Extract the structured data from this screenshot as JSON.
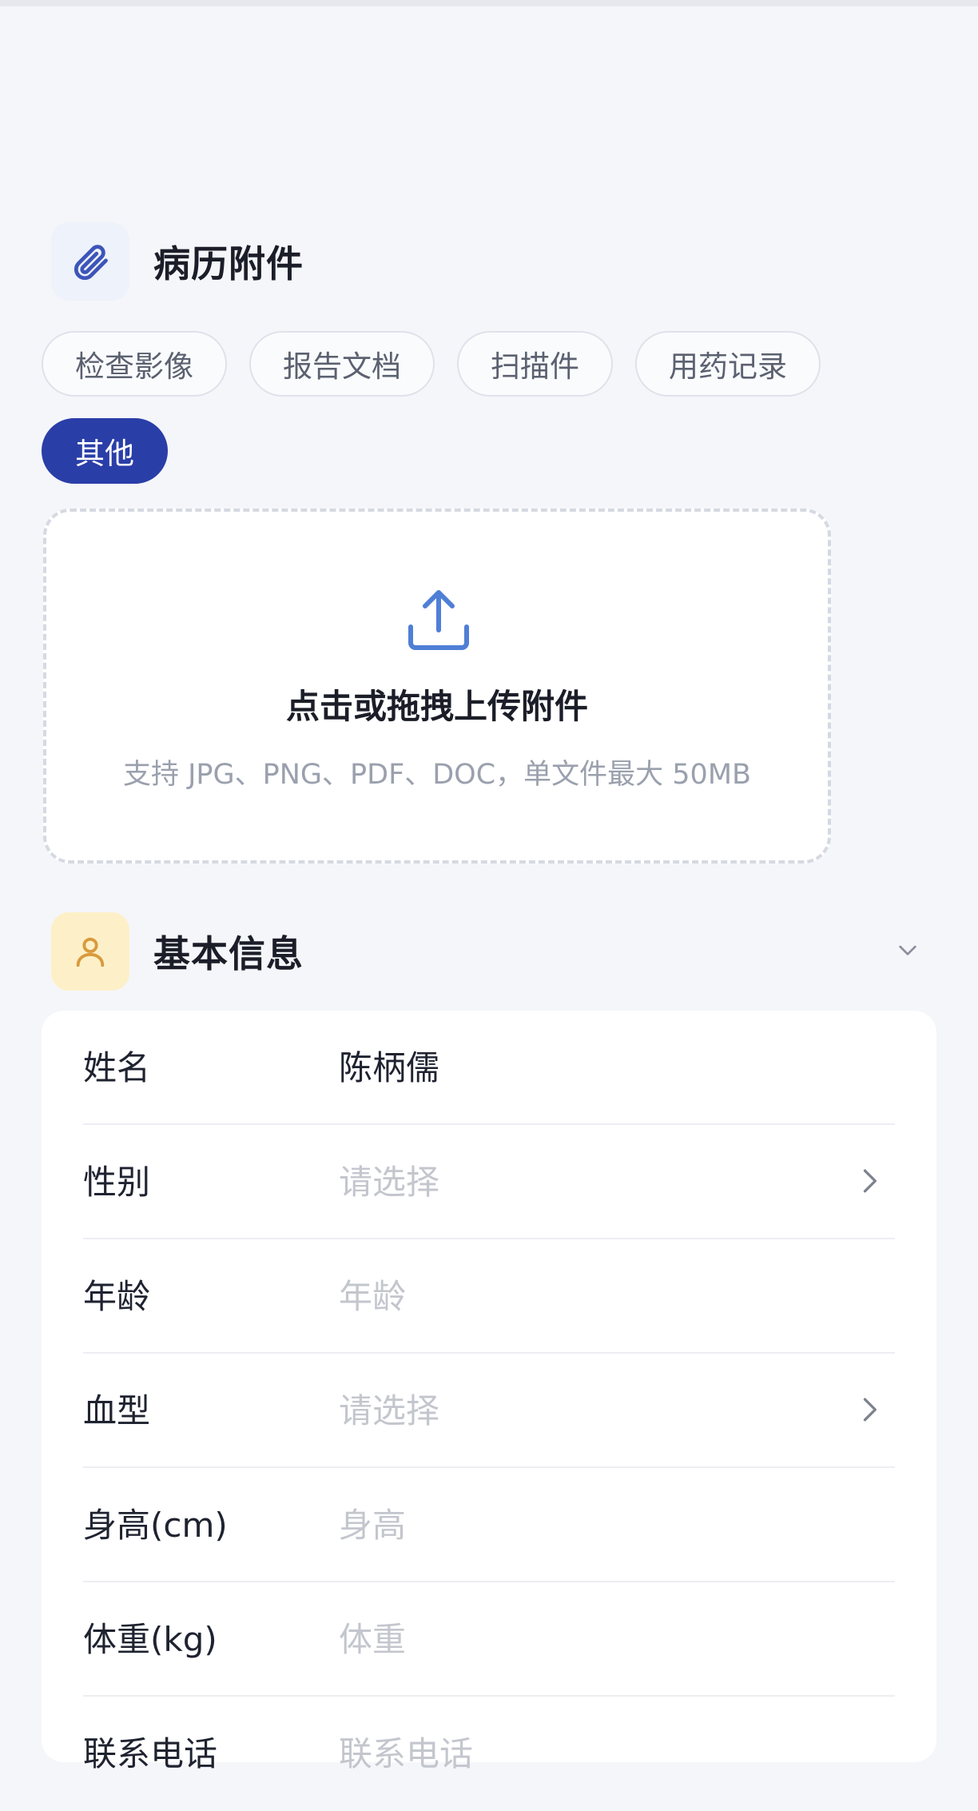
{
  "attachments": {
    "title": "病历附件",
    "icon": "paperclip-icon",
    "categories": [
      {
        "label": "检查影像",
        "active": false
      },
      {
        "label": "报告文档",
        "active": false
      },
      {
        "label": "扫描件",
        "active": false
      },
      {
        "label": "用药记录",
        "active": false
      },
      {
        "label": "其他",
        "active": true
      }
    ],
    "upload": {
      "icon": "upload-icon",
      "title": "点击或拖拽上传附件",
      "hint": "支持 JPG、PNG、PDF、DOC，单文件最大 50MB"
    }
  },
  "basic_info": {
    "title": "基本信息",
    "icon": "user-icon",
    "toggle_icon": "chevron-down-icon",
    "fields": [
      {
        "label": "姓名",
        "value": "陈柄儒",
        "placeholder": "",
        "type": "input"
      },
      {
        "label": "性别",
        "value": "",
        "placeholder": "请选择",
        "type": "select"
      },
      {
        "label": "年龄",
        "value": "",
        "placeholder": "年龄",
        "type": "input"
      },
      {
        "label": "血型",
        "value": "",
        "placeholder": "请选择",
        "type": "select"
      },
      {
        "label": "身高(cm)",
        "value": "",
        "placeholder": "身高",
        "type": "input"
      },
      {
        "label": "体重(kg)",
        "value": "",
        "placeholder": "体重",
        "type": "input"
      },
      {
        "label": "联系电话",
        "value": "",
        "placeholder": "联系电话",
        "type": "input"
      }
    ]
  },
  "colors": {
    "accent": "#2a3ea8",
    "upload_icon": "#4f7fd6",
    "user_icon_bg": "#fdf0c8",
    "user_icon": "#d99a3c",
    "clip_icon_bg": "#eef2fb",
    "clip_icon": "#3d55b8"
  }
}
